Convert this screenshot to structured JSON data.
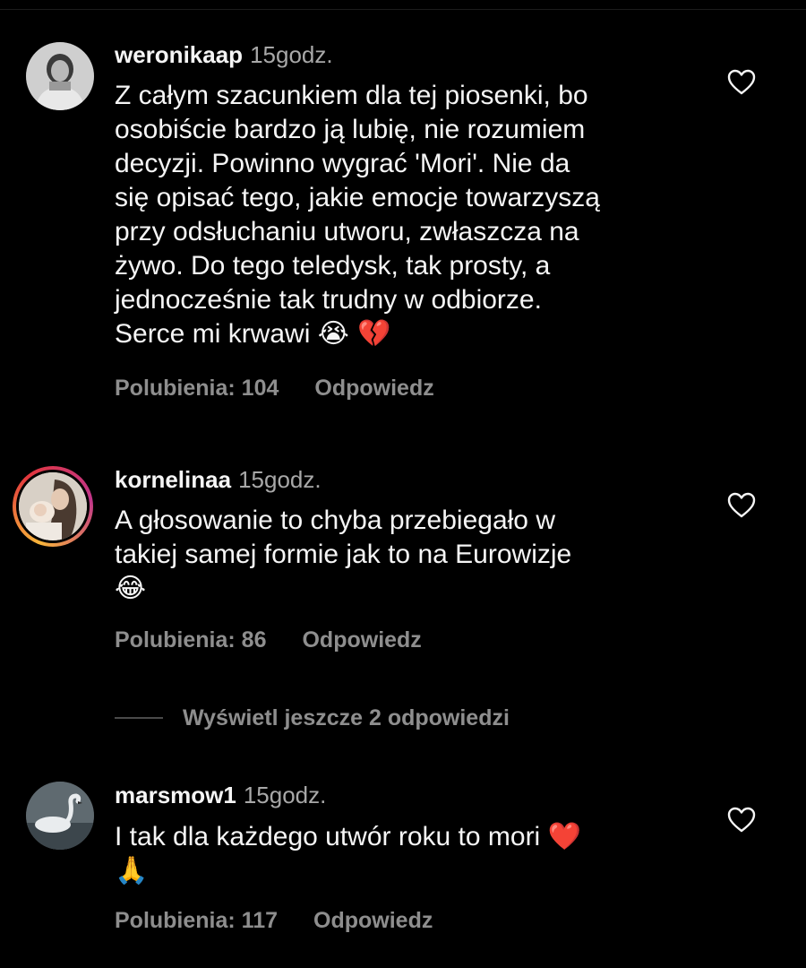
{
  "comments": [
    {
      "username": "weronikaap",
      "time": "15godz.",
      "text": "Z całym szacunkiem dla tej piosenki, bo\nosobiście bardzo ją lubię, nie rozumiem\ndecyzji. Powinno wygrać 'Mori'. Nie da\nsię opisać tego, jakie emocje towarzyszą\nprzy odsłuchaniu utworu, zwłaszcza na\nżywo. Do tego teledysk, tak prosty, a\njednocześnie tak trudny w odbiorze.\nSerce mi krwawi ",
      "emojis": "😭 💔",
      "likes": "Polubienia: 104",
      "reply": "Odpowiedz",
      "avatar_icon": "user-photo-avatar"
    },
    {
      "username": "kornelinaa",
      "time": "15godz.",
      "text": "A głosowanie to chyba przebiegało w\ntakiej samej formie jak to na Eurowizje\n",
      "emojis": "😂",
      "likes": "Polubienia: 86",
      "reply": "Odpowiedz",
      "avatar_icon": "story-ring-avatar"
    },
    {
      "username": "marsmow1",
      "time": "15godz.",
      "text": "I tak dla każdego utwór roku to mori ",
      "emojis": "❤️",
      "emojis2": "🙏",
      "likes": "Polubienia: 117",
      "reply": "Odpowiedz",
      "avatar_icon": "swan-photo-avatar"
    }
  ],
  "view_replies": "Wyświetl jeszcze 2 odpowiedzi",
  "icons": {
    "like": "heart-outline-icon"
  },
  "colors": {
    "background": "#000000",
    "primary_text": "#f5f5f5",
    "secondary_text": "#8e8e8e",
    "story_ring": "#e2373d"
  }
}
